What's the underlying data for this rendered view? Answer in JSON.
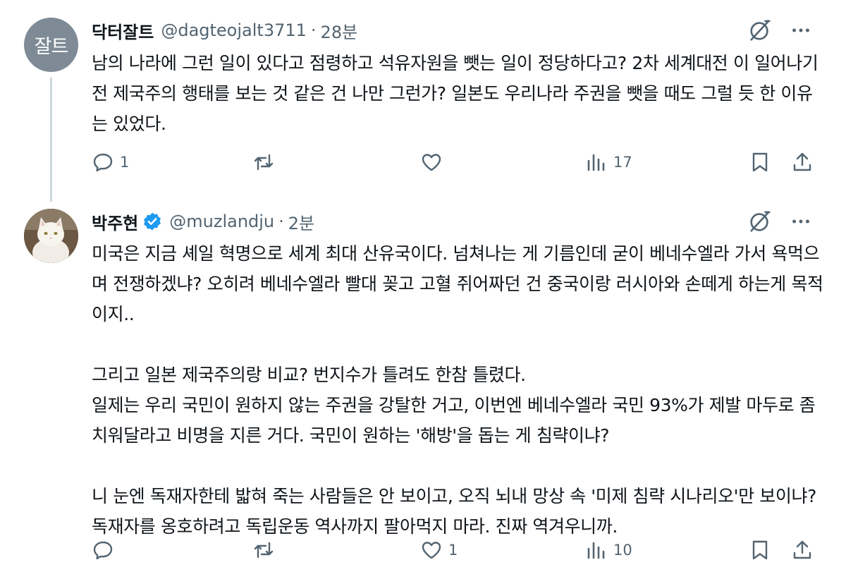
{
  "tweets": [
    {
      "avatar_text": "잘트",
      "name": "닥터잘트",
      "handle": "@dagteojalt3711",
      "separator": "·",
      "time": "28분",
      "text": "남의 나라에 그런 일이 있다고 점령하고 석유자원을 뺏는 일이 정당하다고?  2차 세계대전 이 일어나기 전 제국주의 행태를 보는 것 같은 건 나만 그런가?  일본도 우리나라 주권을 뺏을 때도 그럴 듯 한 이유는 있었다.",
      "stats": {
        "replies": "1",
        "reposts": "",
        "likes": "",
        "views": "17"
      }
    },
    {
      "avatar_image": "white-cat-photo",
      "name": "박주현",
      "verified": true,
      "handle": "@muzlandju",
      "separator": "·",
      "time": "2분",
      "text": "미국은 지금 셰일 혁명으로 세계 최대 산유국이다. 넘쳐나는 게 기름인데 굳이 베네수엘라 가서 욕먹으며 전쟁하겠냐? 오히려 베네수엘라 빨대 꽂고 고혈 쥐어짜던 건 중국이랑 러시아와 손떼게 하는게 목적이지..\n\n그리고 일본 제국주의랑 비교? 번지수가 틀려도 한참 틀렸다.\n일제는 우리 국민이 원하지 않는 주권을 강탈한 거고, 이번엔 베네수엘라 국민 93%가 제발 마두로 좀 치워달라고 비명을 지른 거다. 국민이 원하는 '해방'을 돕는 게 침략이냐?\n\n니 눈엔 독재자한테 밟혀 죽는 사람들은 안 보이고, 오직 뇌내 망상 속 '미제 침략 시나리오'만 보이냐? 독재자를 옹호하려고 독립운동 역사까지 팔아먹지 마라. 진짜 역겨우니까.",
      "stats": {
        "replies": "",
        "reposts": "",
        "likes": "1",
        "views": "10"
      }
    }
  ],
  "colors": {
    "text": "#0f1419",
    "secondary": "#536471",
    "verified": "#1d9bf0",
    "thread_line": "#cfd9de",
    "avatar_bg": "#7e8a95"
  },
  "icons": [
    "grok-icon",
    "more-icon",
    "reply-icon",
    "repost-icon",
    "like-icon",
    "views-icon",
    "bookmark-icon",
    "share-icon",
    "verified-badge-icon"
  ]
}
